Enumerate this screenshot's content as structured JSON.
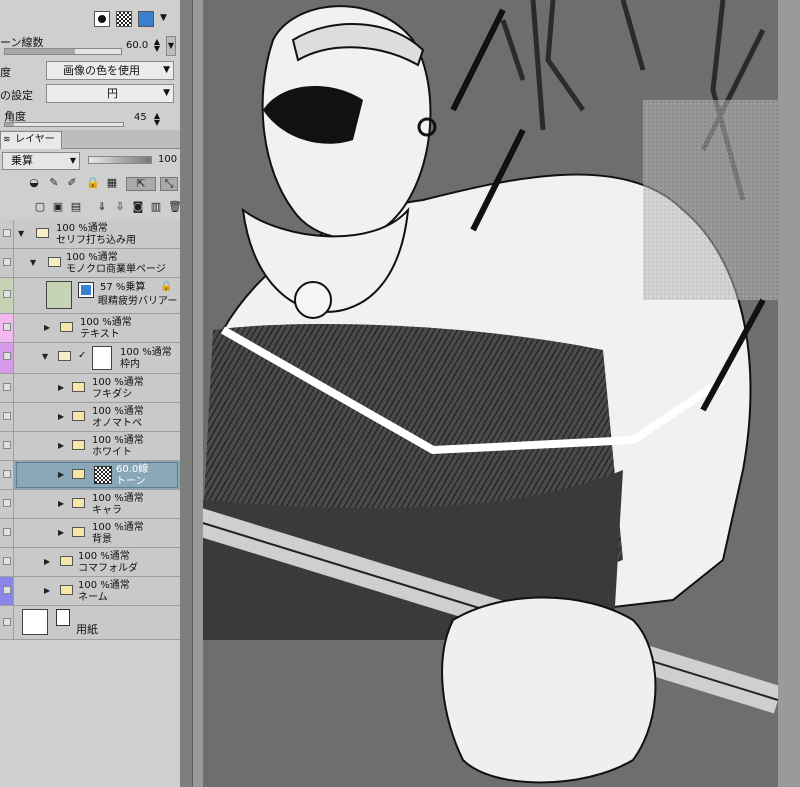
{
  "tool_property": {
    "tone_density_label": "ーン線数",
    "tone_density_value": "60.0",
    "density_label": "度",
    "density_value": "画像の色を使用",
    "shape_label": "の設定",
    "shape_value": "円",
    "angle_label": "角度",
    "angle_value": "45"
  },
  "layer_panel": {
    "tab_label": "レイヤー",
    "blend_mode": "乗算",
    "opacity": "100"
  },
  "layers": [
    {
      "line1": "100 %通常",
      "line2": "セリフ打ち込み用",
      "selected": false
    },
    {
      "line1": "100 %通常",
      "line2": "モノクロ商業単ページ",
      "selected": false
    },
    {
      "line1": "57 %乗算",
      "line2": "眼精疲労バリアー",
      "selected": false
    },
    {
      "line1": "100 %通常",
      "line2": "テキスト",
      "selected": false
    },
    {
      "line1": "100 %通常",
      "line2": "枠内",
      "selected": false
    },
    {
      "line1": "100 %通常",
      "line2": "フキダシ",
      "selected": false
    },
    {
      "line1": "100 %通常",
      "line2": "オノマトペ",
      "selected": false
    },
    {
      "line1": "100 %通常",
      "line2": "ホワイト",
      "selected": false
    },
    {
      "line1": "60.0線",
      "line2": "トーン",
      "selected": true
    },
    {
      "line1": "100 %通常",
      "line2": "キャラ",
      "selected": false
    },
    {
      "line1": "100 %通常",
      "line2": "背景",
      "selected": false
    },
    {
      "line1": "100 %通常",
      "line2": "コマフォルダ",
      "selected": false
    },
    {
      "line1": "100 %通常",
      "line2": "ネーム",
      "selected": false
    },
    {
      "line1": "用紙",
      "line2": "",
      "selected": false
    }
  ],
  "colors": {
    "selected_row": "#8aa7b8",
    "panel_bg": "#cfcfcf",
    "accent_blue": "#3b7fd0"
  }
}
